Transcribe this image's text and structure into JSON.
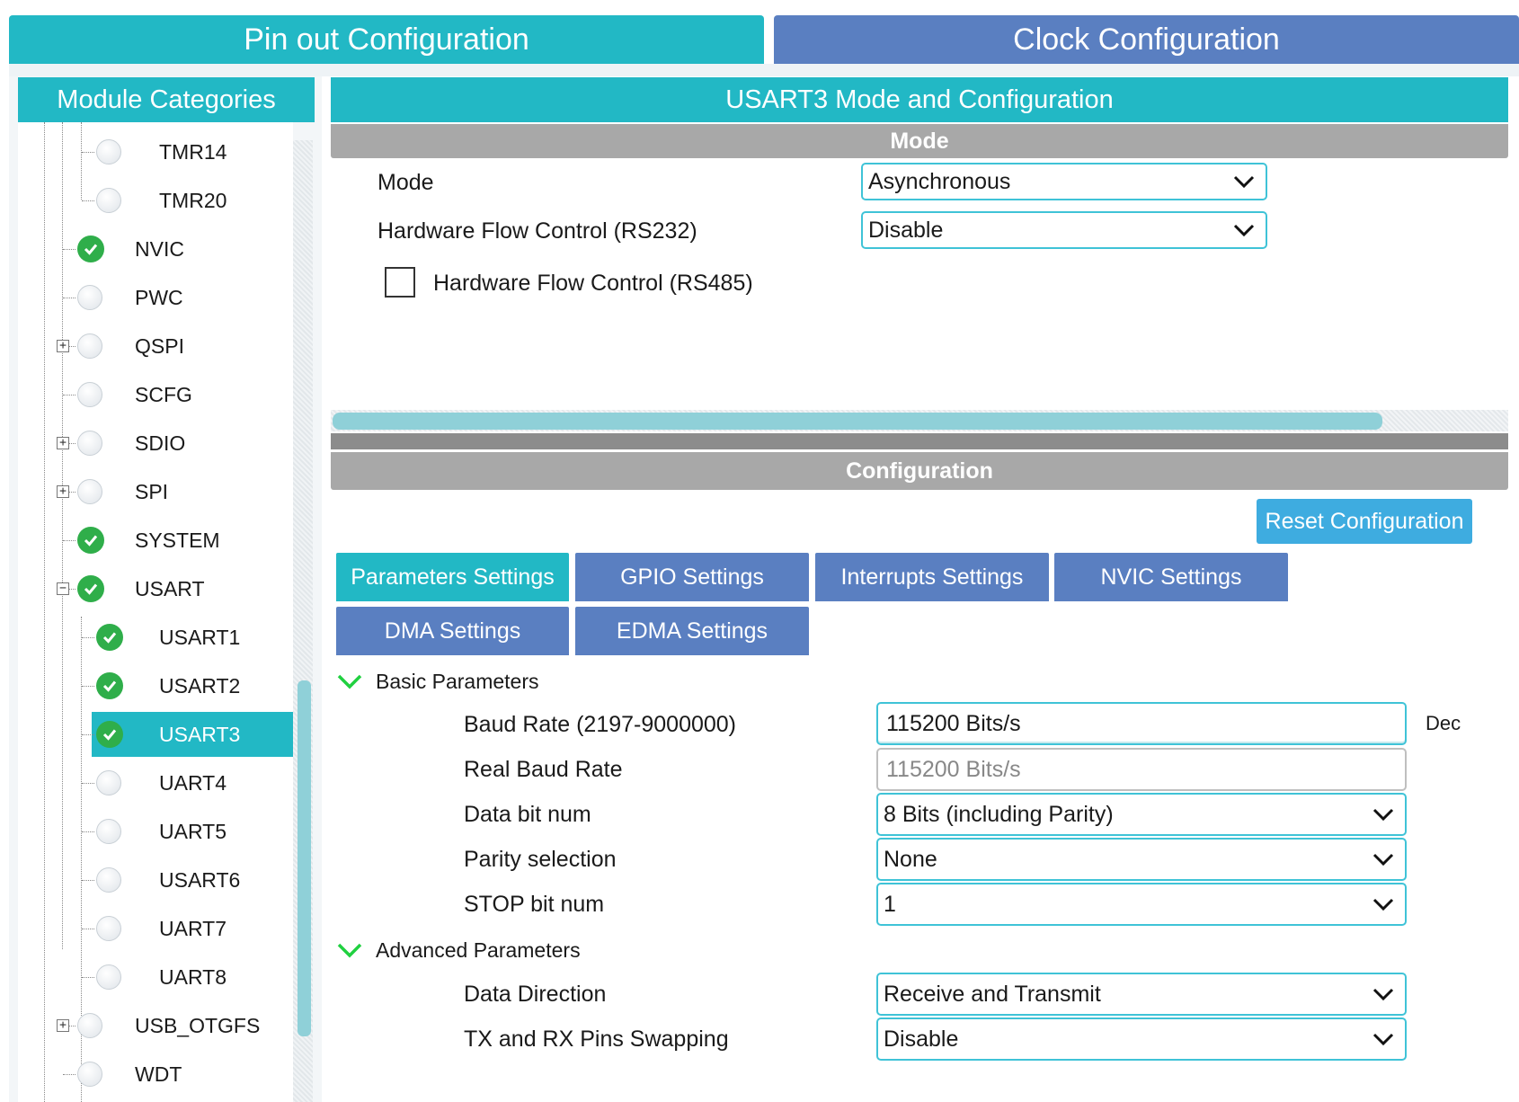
{
  "top_tabs": {
    "pinout": "Pin out  Configuration",
    "clock": "Clock Configuration"
  },
  "left": {
    "header": "Module Categories",
    "tree": [
      {
        "label": "TMR14",
        "status": "unused",
        "level": 2
      },
      {
        "label": "TMR20",
        "status": "unused",
        "level": 2
      },
      {
        "label": "NVIC",
        "status": "enabled",
        "level": 1
      },
      {
        "label": "PWC",
        "status": "unused",
        "level": 1
      },
      {
        "label": "QSPI",
        "status": "unused",
        "level": 1,
        "expander": "+"
      },
      {
        "label": "SCFG",
        "status": "unused",
        "level": 1
      },
      {
        "label": "SDIO",
        "status": "unused",
        "level": 1,
        "expander": "+"
      },
      {
        "label": "SPI",
        "status": "unused",
        "level": 1,
        "expander": "+"
      },
      {
        "label": "SYSTEM",
        "status": "enabled",
        "level": 1
      },
      {
        "label": "USART",
        "status": "enabled",
        "level": 1,
        "expander": "−"
      },
      {
        "label": "USART1",
        "status": "enabled",
        "level": 2
      },
      {
        "label": "USART2",
        "status": "enabled",
        "level": 2
      },
      {
        "label": "USART3",
        "status": "enabled",
        "level": 2,
        "selected": true
      },
      {
        "label": "UART4",
        "status": "unused",
        "level": 2
      },
      {
        "label": "UART5",
        "status": "unused",
        "level": 2
      },
      {
        "label": "USART6",
        "status": "unused",
        "level": 2
      },
      {
        "label": "UART7",
        "status": "unused",
        "level": 2
      },
      {
        "label": "UART8",
        "status": "unused",
        "level": 2
      },
      {
        "label": "USB_OTGFS",
        "status": "unused",
        "level": 1,
        "expander": "+"
      },
      {
        "label": "WDT",
        "status": "unused",
        "level": 1
      }
    ]
  },
  "main": {
    "header": "USART3 Mode and Configuration",
    "mode_section": "Mode",
    "mode": {
      "mode_label": "Mode",
      "mode_value": "Asynchronous",
      "hfc232_label": "Hardware Flow Control (RS232)",
      "hfc232_value": "Disable",
      "hfc485_label": "Hardware Flow Control (RS485)"
    },
    "config_section": "Configuration",
    "reset_label": "Reset Configuration",
    "tabs": [
      "Parameters Settings",
      "GPIO Settings",
      "Interrupts Settings",
      "NVIC Settings",
      "DMA Settings",
      "EDMA Settings"
    ],
    "basic": {
      "title": "Basic Parameters",
      "baud_label": "Baud Rate (2197-9000000)",
      "baud_value": "115200 Bits/s",
      "baud_unit": "Dec",
      "real_baud_label": "Real Baud Rate",
      "real_baud_value": "115200 Bits/s",
      "databits_label": "Data bit num",
      "databits_value": "8 Bits (including Parity)",
      "parity_label": "Parity selection",
      "parity_value": "None",
      "stop_label": "STOP bit num",
      "stop_value": "1"
    },
    "advanced": {
      "title": "Advanced Parameters",
      "direction_label": "Data Direction",
      "direction_value": "Receive and Transmit",
      "swap_label": "TX and RX Pins Swapping",
      "swap_value": "Disable"
    }
  },
  "colors": {
    "teal": "#22b8c5",
    "blue": "#5a7fc1",
    "check_green": "#2fae4a",
    "gray_bar": "#a8a8a8"
  }
}
